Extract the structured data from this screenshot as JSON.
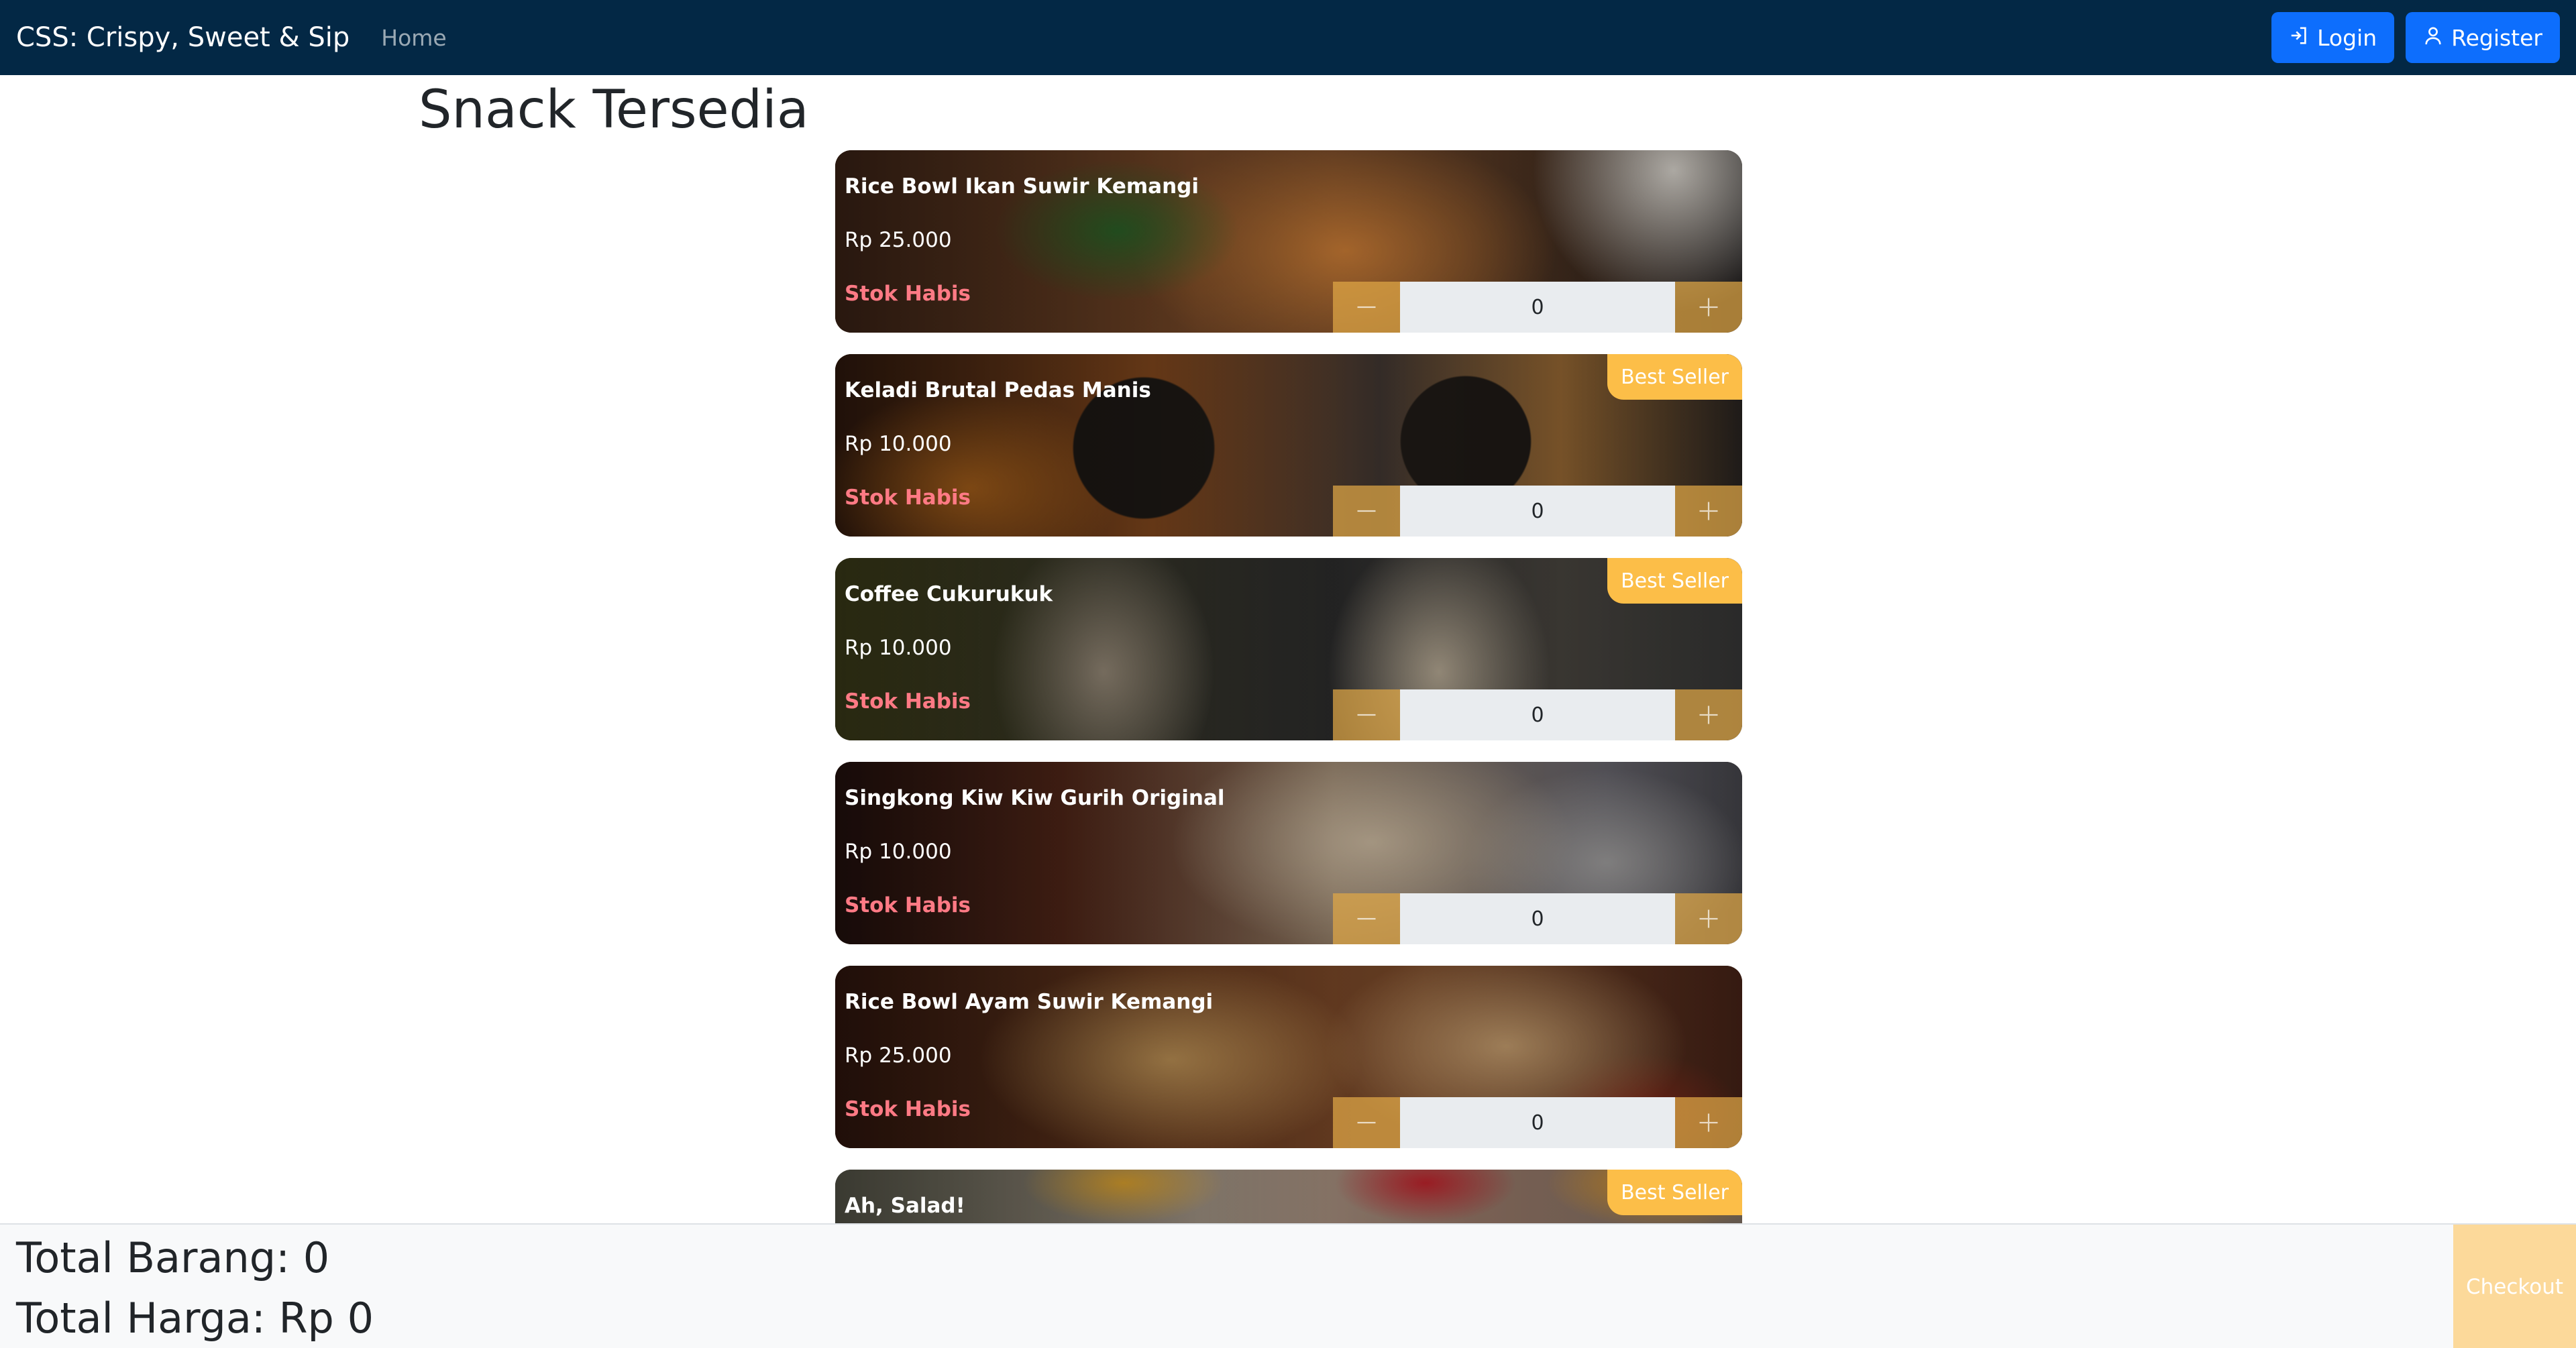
{
  "navbar": {
    "brand": "CSS: Crispy, Sweet & Sip",
    "home_link": "Home",
    "login_label": "Login",
    "register_label": "Register"
  },
  "page": {
    "title": "Snack Tersedia"
  },
  "products": [
    {
      "name": "Rice Bowl Ikan Suwir Kemangi",
      "price": "Rp 25.000",
      "stock_status": "Stok Habis",
      "quantity": "0",
      "badge": ""
    },
    {
      "name": "Keladi Brutal Pedas Manis",
      "price": "Rp 10.000",
      "stock_status": "Stok Habis",
      "quantity": "0",
      "badge": "Best Seller"
    },
    {
      "name": "Coffee Cukurukuk",
      "price": "Rp 10.000",
      "stock_status": "Stok Habis",
      "quantity": "0",
      "badge": "Best Seller"
    },
    {
      "name": "Singkong Kiw Kiw Gurih Original",
      "price": "Rp 10.000",
      "stock_status": "Stok Habis",
      "quantity": "0",
      "badge": ""
    },
    {
      "name": "Rice Bowl Ayam Suwir Kemangi",
      "price": "Rp 25.000",
      "stock_status": "Stok Habis",
      "quantity": "0",
      "badge": ""
    },
    {
      "name": "Ah, Salad!",
      "price": "",
      "stock_status": "",
      "quantity": "",
      "badge": "Best Seller"
    }
  ],
  "summary": {
    "total_items": "Total Barang: 0",
    "total_price": "Total Harga: Rp 0",
    "checkout_label": "Checkout"
  },
  "icons": {
    "login": "login-icon",
    "register": "user-icon",
    "decrement": "minus-icon",
    "increment": "plus-icon"
  },
  "colors": {
    "navbar_bg": "#032845",
    "primary": "#0d6efd",
    "badge": "#fcbe48",
    "stock_out": "#ff7a85",
    "qty_button": "#e0a846",
    "checkout_bg": "#fcd99a",
    "footer_bg": "#f8f9fa"
  }
}
